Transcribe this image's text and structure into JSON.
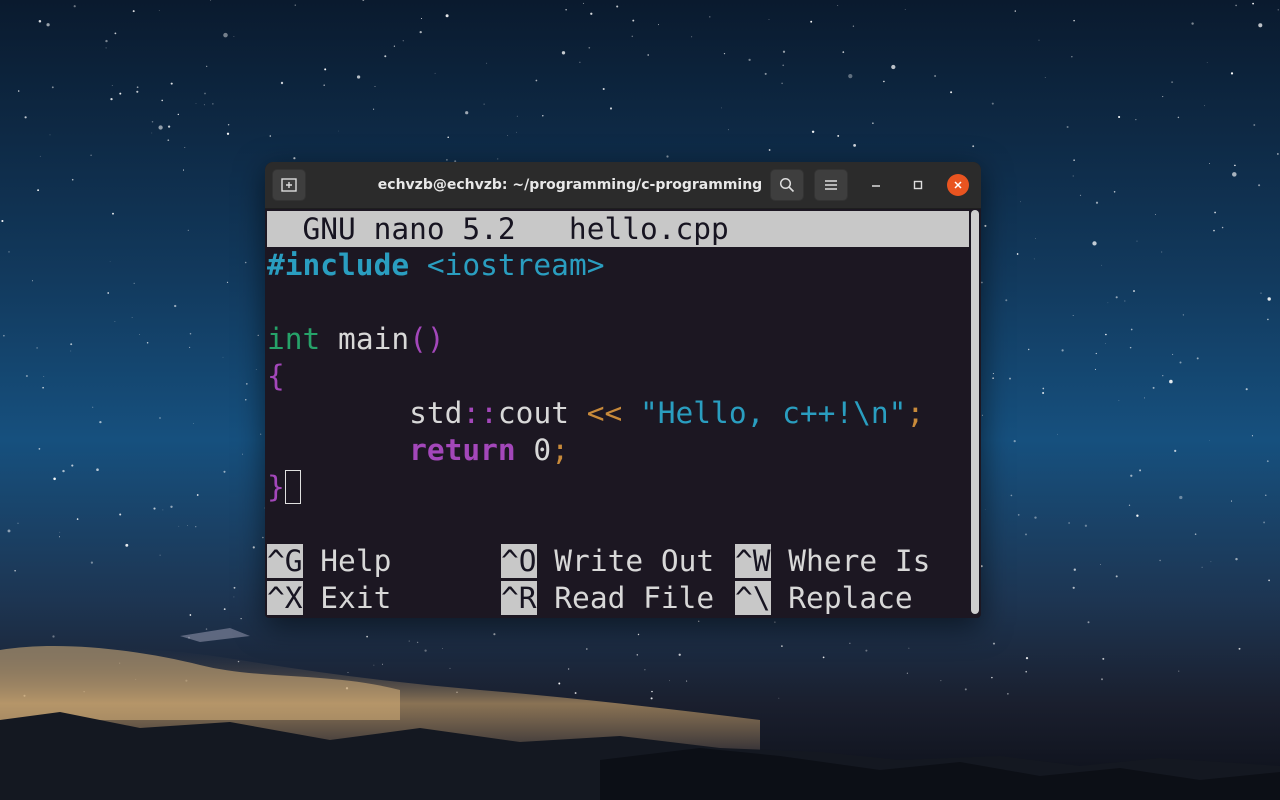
{
  "window": {
    "title": "echvzb@echvzb: ~/programming/c-programming"
  },
  "nano": {
    "header": "  GNU nano 5.2   hello.cpp",
    "code": {
      "include_kw": "#include",
      "include_target": " <iostream>",
      "int_kw": "int",
      "main_name": " main",
      "main_parens": "()",
      "open_brace": "{",
      "indent": "        ",
      "std": "std",
      "scope_op": "::",
      "cout": "cout",
      "shift_op": " << ",
      "string_lit": "\"Hello, c++!\\n\"",
      "semicolon": ";",
      "return_kw": "return",
      "return_val": " 0",
      "close_brace": "}"
    },
    "shortcuts": [
      {
        "key": "^G",
        "label": " Help"
      },
      {
        "key": "^O",
        "label": " Write Out"
      },
      {
        "key": "^W",
        "label": " Where Is"
      },
      {
        "key": "^X",
        "label": " Exit"
      },
      {
        "key": "^R",
        "label": " Read File"
      },
      {
        "key": "^\\",
        "label": " Replace"
      }
    ]
  },
  "icons": {
    "new_tab": "new-tab-icon",
    "search": "search-icon",
    "menu": "hamburger-menu-icon",
    "minimize": "minimize-icon",
    "maximize": "maximize-icon",
    "close": "close-icon"
  },
  "colors": {
    "terminal_bg": "#1c1722",
    "close_button": "#e95420",
    "keyword_purple": "#a347ba",
    "type_green": "#26a269",
    "string_cyan": "#2a9ec0",
    "operator_orange": "#c88a3a"
  }
}
